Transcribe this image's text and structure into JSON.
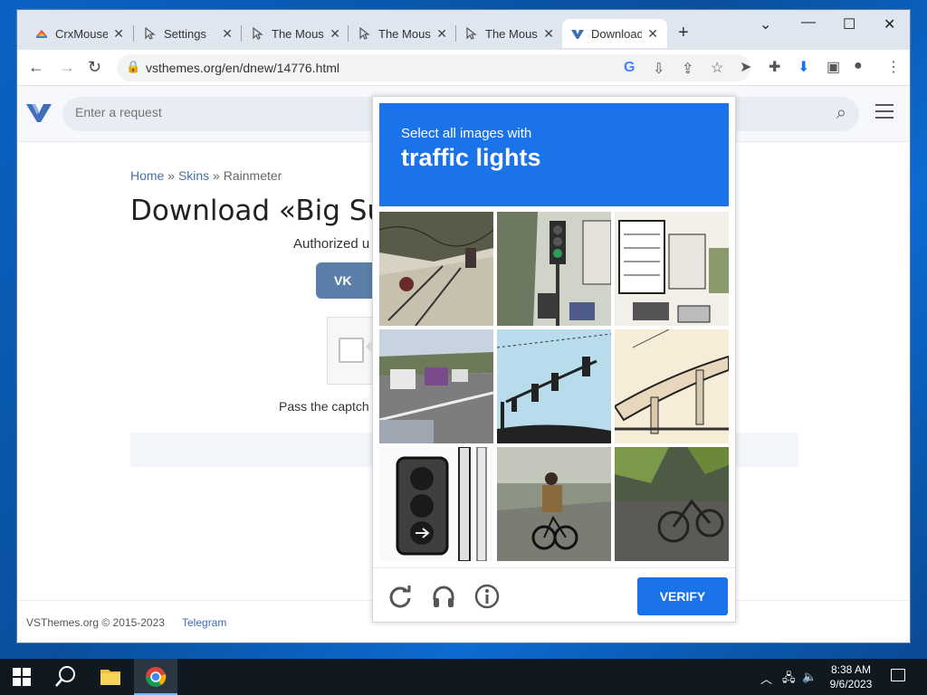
{
  "browser": {
    "tabs": [
      {
        "title": "CrxMouse",
        "icon": "crxmouse-icon"
      },
      {
        "title": "Settings",
        "icon": "cursor-icon"
      },
      {
        "title": "The Mous",
        "icon": "cursor-icon"
      },
      {
        "title": "The Mous",
        "icon": "cursor-icon"
      },
      {
        "title": "The Mous",
        "icon": "cursor-icon"
      },
      {
        "title": "Download",
        "icon": "vsthemes-icon",
        "active": true
      }
    ],
    "new_tab": "+",
    "url": "vsthemes.org/en/dnew/14776.html"
  },
  "site": {
    "search_placeholder": "Enter a request",
    "breadcrumb": {
      "home": "Home",
      "sep1": " » ",
      "skins": "Skins",
      "sep2": " » ",
      "current": "Rainmeter"
    },
    "title": "Download «Big Su",
    "authorized": "Authorized u",
    "vk_label": "VK",
    "pass_captcha": "Pass the captch",
    "footer_copy": "VSThemes.org © 2015-2023",
    "footer_link": "Telegram"
  },
  "captcha": {
    "prompt_small": "Select all images with",
    "prompt_big": "traffic lights",
    "verify": "VERIFY",
    "accent": "#1a73e8"
  },
  "taskbar": {
    "time": "8:38 AM",
    "date": "9/6/2023"
  }
}
